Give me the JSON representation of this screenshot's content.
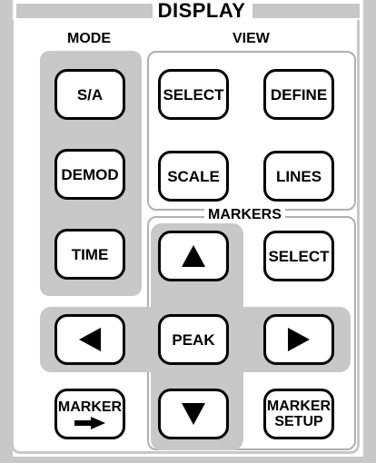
{
  "panel": {
    "title": "DISPLAY"
  },
  "sections": {
    "mode": "MODE",
    "view": "VIEW",
    "markers": "MARKERS"
  },
  "mode_buttons": [
    {
      "label": "S/A"
    },
    {
      "label": "DEMOD"
    },
    {
      "label": "TIME"
    }
  ],
  "view_buttons": [
    {
      "label": "SELECT"
    },
    {
      "label": "DEFINE"
    },
    {
      "label": "SCALE"
    },
    {
      "label": "LINES"
    }
  ],
  "marker_buttons": {
    "select": "SELECT",
    "peak": "PEAK",
    "marker_to_line1": "MARKER",
    "marker_setup_line1": "MARKER",
    "marker_setup_line2": "SETUP",
    "up_icon": "arrow-up-icon",
    "down_icon": "arrow-down-icon",
    "left_icon": "arrow-left-icon",
    "right_icon": "arrow-right-icon",
    "marker_to_icon": "right-arrow-icon"
  },
  "colors": {
    "panel_gray": "#c8c8c8",
    "frame_gray": "#b0b0b0",
    "ink": "#000000"
  }
}
